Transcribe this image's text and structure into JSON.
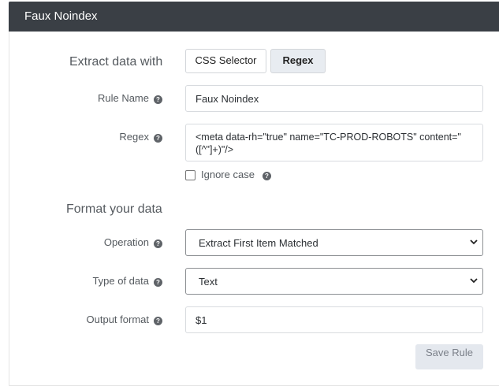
{
  "header": {
    "title": "Faux Noindex"
  },
  "extract": {
    "label": "Extract data with",
    "options": [
      "CSS Selector",
      "Regex"
    ],
    "selected": "Regex"
  },
  "rule_name": {
    "label": "Rule Name",
    "value": "Faux Noindex"
  },
  "regex": {
    "label": "Regex",
    "value": "<meta data-rh=\"true\" name=\"TC-PROD-ROBOTS\" content=\"([^\"]+)\"/>",
    "line1": "<meta data-rh=\"true\" name=\"TC-PROD-ROBOTS\" content=\"",
    "line2": "([^\"]+)\"/>"
  },
  "ignore_case": {
    "label": "Ignore case",
    "checked": false
  },
  "format": {
    "title": "Format your data",
    "operation": {
      "label": "Operation",
      "value": "Extract First Item Matched"
    },
    "type": {
      "label": "Type of data",
      "value": "Text"
    },
    "output": {
      "label": "Output format",
      "value": "$1"
    }
  },
  "actions": {
    "save_label": "Save Rule"
  },
  "icons": {
    "help": "question-circle-icon",
    "chevron": "chevron-down-icon"
  }
}
